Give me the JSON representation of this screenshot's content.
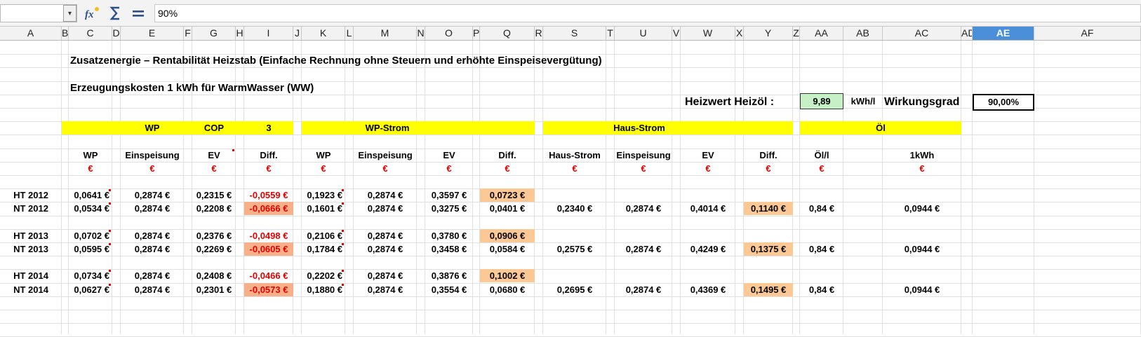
{
  "formula_bar": {
    "name_box": "",
    "content": "90%"
  },
  "columns": [
    "A",
    "B",
    "C",
    "D",
    "E",
    "F",
    "G",
    "H",
    "I",
    "J",
    "K",
    "L",
    "M",
    "N",
    "O",
    "P",
    "Q",
    "R",
    "S",
    "T",
    "U",
    "V",
    "W",
    "X",
    "Y",
    "Z",
    "AA",
    "AB",
    "AC",
    "AD",
    "AE",
    "AF"
  ],
  "selected_column": "AE",
  "sheet": {
    "title": "Zusatzenergie – Rentabilität Heizstab  (Einfache Rechnung ohne Steuern und erhöhte Einspeisevergütung)",
    "subtitle": "Erzeugungskosten 1 kWh für WarmWasser (WW)",
    "heizwert_label": "Heizwert Heizöl :",
    "heizwert_value": "9,89",
    "heizwert_unit": "kWh/l",
    "wirkungsgrad_label": "Wirkungsgrad",
    "wirkungsgrad_value": "90,00%",
    "band_wp": "WP",
    "band_cop": "COP",
    "band_cop_value": "3",
    "band_wpstrom": "WP-Strom",
    "band_hausstrom": "Haus-Strom",
    "band_oel": "Öl",
    "headers": {
      "wp": "WP",
      "einsp1": "Einspeisung",
      "ev1": "EV",
      "diff1": "Diff.",
      "wp2": "WP",
      "einsp2": "Einspeisung",
      "ev2": "EV",
      "diff2": "Diff.",
      "haus": "Haus-Strom",
      "einsp3": "Einspeisung",
      "ev3": "EV",
      "diff3": "Diff.",
      "oel": "Öl/l",
      "kwh": "1kWh"
    },
    "euro": "€",
    "rows": [
      {
        "label": "HT 2012",
        "wp": "0,0641 €",
        "e1": "0,2874 €",
        "ev1": "0,2315 €",
        "d1": "-0,0559 €",
        "wp2": "0,1923 €",
        "e2": "0,2874 €",
        "ev2": "0,3597 €",
        "d2": "0,0723 €",
        "haus": "",
        "e3": "",
        "ev3": "",
        "d3": "",
        "oel": "",
        "kwh": ""
      },
      {
        "label": "NT 2012",
        "wp": "0,0534 €",
        "e1": "0,2874 €",
        "ev1": "0,2208 €",
        "d1": "-0,0666 €",
        "wp2": "0,1601 €",
        "e2": "0,2874 €",
        "ev2": "0,3275 €",
        "d2": "0,0401 €",
        "haus": "0,2340 €",
        "e3": "0,2874 €",
        "ev3": "0,4014 €",
        "d3": "0,1140 €",
        "oel": "0,84 €",
        "kwh": "0,0944 €"
      },
      {
        "label": "HT 2013",
        "wp": "0,0702 €",
        "e1": "0,2874 €",
        "ev1": "0,2376 €",
        "d1": "-0,0498 €",
        "wp2": "0,2106 €",
        "e2": "0,2874 €",
        "ev2": "0,3780 €",
        "d2": "0,0906 €",
        "haus": "",
        "e3": "",
        "ev3": "",
        "d3": "",
        "oel": "",
        "kwh": ""
      },
      {
        "label": "NT 2013",
        "wp": "0,0595 €",
        "e1": "0,2874 €",
        "ev1": "0,2269 €",
        "d1": "-0,0605 €",
        "wp2": "0,1784 €",
        "e2": "0,2874 €",
        "ev2": "0,3458 €",
        "d2": "0,0584 €",
        "haus": "0,2575 €",
        "e3": "0,2874 €",
        "ev3": "0,4249 €",
        "d3": "0,1375 €",
        "oel": "0,84 €",
        "kwh": "0,0944 €"
      },
      {
        "label": "HT 2014",
        "wp": "0,0734 €",
        "e1": "0,2874 €",
        "ev1": "0,2408 €",
        "d1": "-0,0466 €",
        "wp2": "0,2202 €",
        "e2": "0,2874 €",
        "ev2": "0,3876 €",
        "d2": "0,1002 €",
        "haus": "",
        "e3": "",
        "ev3": "",
        "d3": "",
        "oel": "",
        "kwh": ""
      },
      {
        "label": "NT 2014",
        "wp": "0,0627 €",
        "e1": "0,2874 €",
        "ev1": "0,2301 €",
        "d1": "-0,0573 €",
        "wp2": "0,1880 €",
        "e2": "0,2874 €",
        "ev2": "0,3554 €",
        "d2": "0,0680 €",
        "haus": "0,2695 €",
        "e3": "0,2874 €",
        "ev3": "0,4369 €",
        "d3": "0,1495 €",
        "oel": "0,84 €",
        "kwh": "0,0944 €"
      }
    ]
  },
  "colors": {
    "band": "#ffff00",
    "negative": "#e00000",
    "highlight": "#fbc896",
    "input_green": "#c6f0c6",
    "selection": "#4a8fd8"
  }
}
